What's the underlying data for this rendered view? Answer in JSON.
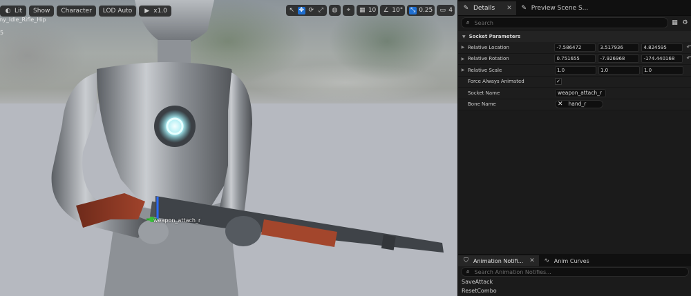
{
  "viewport": {
    "toolbar": {
      "lit": "Lit",
      "show": "Show",
      "character": "Character",
      "lod": "LOD Auto",
      "playback": "x1.0"
    },
    "animation_name": "nny_Idle_Rifle_Hip",
    "frame": "5",
    "right_toolbar": {
      "grid_size": "10",
      "rotation_snap": "10°",
      "scale_snap": "0.25",
      "camera_speed": "4"
    },
    "socket_label": "weapon_attach_r"
  },
  "details": {
    "tabs": [
      {
        "label": "Details",
        "active": true,
        "closable": true
      },
      {
        "label": "Preview Scene S...",
        "active": false,
        "closable": false
      }
    ],
    "search_placeholder": "Search",
    "section": "Socket Parameters",
    "relative_location": {
      "label": "Relative Location",
      "x": "-7.586472",
      "y": "3.517936",
      "z": "4.824595"
    },
    "relative_rotation": {
      "label": "Relative Rotation",
      "x": "0.751655",
      "y": "-7.926968",
      "z": "-174.440168"
    },
    "relative_scale": {
      "label": "Relative Scale",
      "x": "1.0",
      "y": "1.0",
      "z": "1.0"
    },
    "force_always_animated": {
      "label": "Force Always Animated",
      "checked": true
    },
    "socket_name": {
      "label": "Socket Name",
      "value": "weapon_attach_r"
    },
    "bone_name": {
      "label": "Bone Name",
      "value": "hand_r"
    }
  },
  "notifies": {
    "tabs": [
      {
        "label": "Animation Notifi...",
        "active": true
      },
      {
        "label": "Anim Curves",
        "active": false
      }
    ],
    "search_placeholder": "Search Animation Notifies...",
    "items": [
      "SaveAttack",
      "ResetCombo"
    ]
  },
  "colors": {
    "accent_blue": "#1f6fd1",
    "panel_bg": "#1b1b1b",
    "field_bg": "#0f0f0f"
  }
}
